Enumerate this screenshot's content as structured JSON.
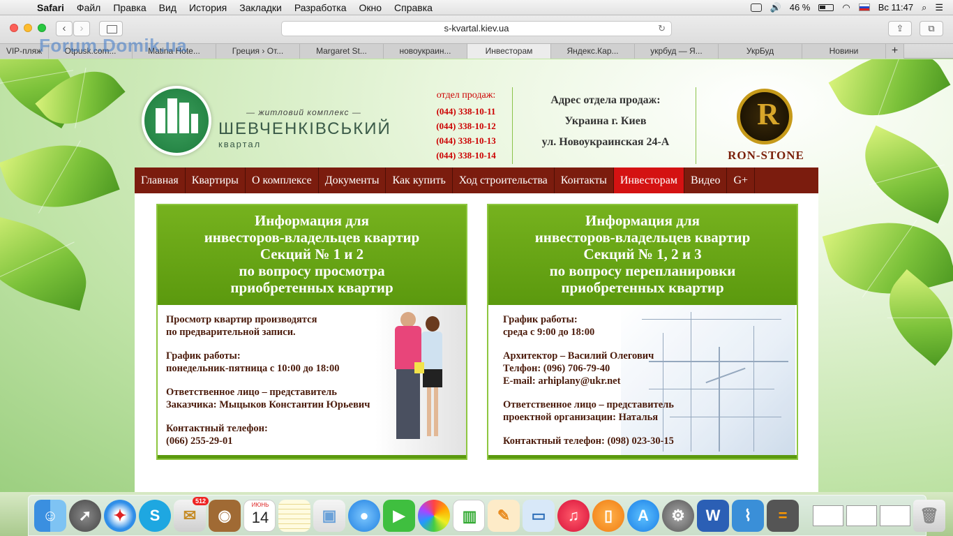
{
  "menubar": {
    "app": "Safari",
    "items": [
      "Файл",
      "Правка",
      "Вид",
      "История",
      "Закладки",
      "Разработка",
      "Окно",
      "Справка"
    ],
    "battery": "46 %",
    "clock": "Вс 11:47"
  },
  "browser": {
    "url": "s-kvartal.kiev.ua",
    "tabs": [
      "VIP-пляж",
      "Otpusk.com...",
      "Matina Hote...",
      "Греция › От...",
      "Margaret St...",
      "новоукраин...",
      "Инвесторам",
      "Яндекс.Кар...",
      "укрбуд — Я...",
      "УкрБуд",
      "Новини"
    ],
    "active_tab": 6,
    "watermark": "Forum.Domik.ua"
  },
  "header": {
    "logo_tagline": "— житловий комплекс —",
    "logo_name": "ШЕВЧЕНКІВСЬКИЙ",
    "logo_sub": "квартал",
    "sales_label": "отдел продаж:",
    "phones": [
      "(044) 338-10-11",
      "(044) 338-10-12",
      "(044) 338-10-13",
      "(044) 338-10-14"
    ],
    "address_title": "Адрес отдела продаж:",
    "address_city": "Украина г. Киев",
    "address_street": "ул. Новоукраинская 24-А",
    "partner_letter": "R",
    "partner_name": "RON-STONE"
  },
  "nav": [
    "Главная",
    "Квартиры",
    "О комплексе",
    "Документы",
    "Как купить",
    "Ход строительства",
    "Контакты",
    "Инвесторам",
    "Видео",
    "G+"
  ],
  "nav_active": 7,
  "cards": [
    {
      "title_lines": [
        "Информация для",
        "инвесторов-владельцев квартир",
        "Секций № 1 и 2",
        "по вопросу просмотра",
        "приобретенных квартир"
      ],
      "paras": [
        [
          "Просмотр квартир производятся",
          "по предварительной записи."
        ],
        [
          "График работы:",
          "понедельник-пятница с 10:00 до 18:00"
        ],
        [
          "Ответственное лицо – представитель",
          "Заказчика: Мыцыков Константин Юрьевич"
        ],
        [
          "Контактный телефон:",
          "(066) 255-29-01"
        ]
      ]
    },
    {
      "title_lines": [
        "Информация для",
        "инвесторов-владельцев квартир",
        "Секций № 1, 2 и 3",
        "по вопросу перепланировки",
        "приобретенных квартир"
      ],
      "paras": [
        [
          "График работы:",
          "среда с 9:00 до 18:00"
        ],
        [
          "Архитектор – Василий Олегович",
          "Телфон: (096) 706-79-40",
          "E-mail: arhiplany@ukr.net"
        ],
        [
          "Ответственное лицо – представитель",
          "проектной организации: Наталья"
        ],
        [
          "Контактный телефон: (098) 023-30-15"
        ]
      ]
    }
  ],
  "dock": {
    "calendar_month": "ИЮНЬ",
    "calendar_day": "14",
    "mail_badge": "512"
  }
}
